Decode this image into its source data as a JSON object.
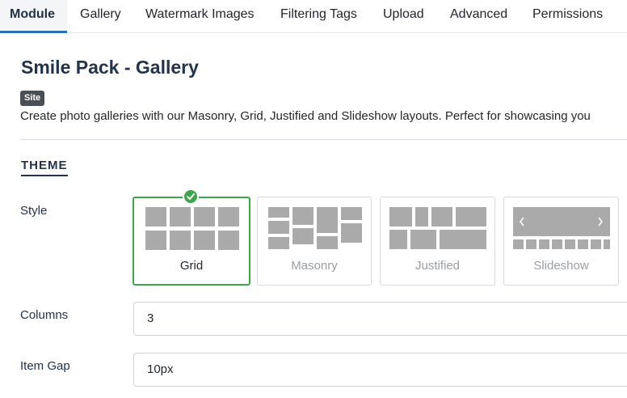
{
  "tabs": [
    {
      "label": "Module",
      "active": true
    },
    {
      "label": "Gallery"
    },
    {
      "label": "Watermark Images"
    },
    {
      "label": "Filtering Tags"
    },
    {
      "label": "Upload"
    },
    {
      "label": "Advanced"
    },
    {
      "label": "Permissions"
    }
  ],
  "header": {
    "title": "Smile Pack - Gallery",
    "badge": "Site",
    "description": "Create photo galleries with our Masonry, Grid, Justified and Slideshow layouts. Perfect for showcasing you"
  },
  "theme": {
    "section_title": "THEME",
    "style_label": "Style",
    "styles": [
      {
        "label": "Grid",
        "selected": true
      },
      {
        "label": "Masonry"
      },
      {
        "label": "Justified"
      },
      {
        "label": "Slideshow"
      }
    ],
    "columns_label": "Columns",
    "columns_value": "3",
    "item_gap_label": "Item Gap",
    "item_gap_value": "10px"
  },
  "colors": {
    "accent_selected": "#3ea64a",
    "active_tab_underline": "#2f6fb5",
    "heading": "#22334b",
    "thumb_gray": "#aaaaaa"
  },
  "icons": {
    "check": "checkmark-circle-icon",
    "slide_prev": "chevron-left-icon",
    "slide_next": "chevron-right-icon"
  }
}
